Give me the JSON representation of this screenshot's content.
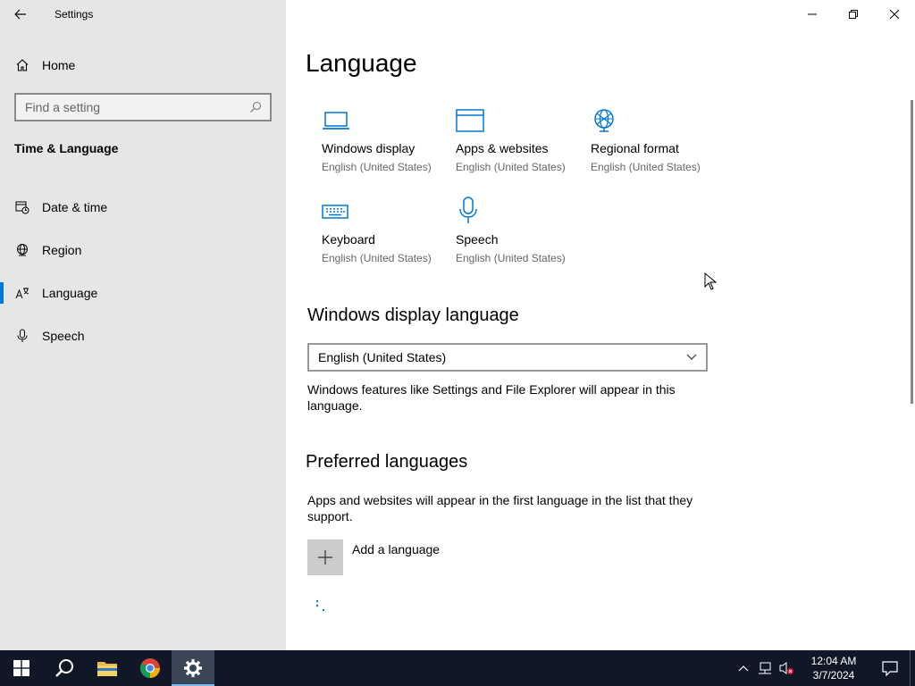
{
  "window": {
    "title": "Settings"
  },
  "sidebar": {
    "home_label": "Home",
    "search_placeholder": "Find a setting",
    "section_title": "Time & Language",
    "items": [
      {
        "label": "Date & time",
        "icon": "clock-calendar-icon",
        "active": false
      },
      {
        "label": "Region",
        "icon": "globe-icon",
        "active": false
      },
      {
        "label": "Language",
        "icon": "language-icon",
        "active": true
      },
      {
        "label": "Speech",
        "icon": "microphone-icon",
        "active": false
      }
    ]
  },
  "main": {
    "page_title": "Language",
    "tiles": [
      {
        "label": "Windows display",
        "sub": "English (United States)",
        "icon": "laptop-icon"
      },
      {
        "label": "Apps & websites",
        "sub": "English (United States)",
        "icon": "browser-window-icon"
      },
      {
        "label": "Regional format",
        "sub": "English (United States)",
        "icon": "regional-globe-icon"
      },
      {
        "label": "Keyboard",
        "sub": "English (United States)",
        "icon": "keyboard-icon"
      },
      {
        "label": "Speech",
        "sub": "English (United States)",
        "icon": "microphone-icon"
      }
    ],
    "display_language": {
      "heading": "Windows display language",
      "selected": "English (United States)",
      "description": "Windows features like Settings and File Explorer will appear in this language."
    },
    "preferred": {
      "heading": "Preferred languages",
      "description": "Apps and websites will appear in the first language in the list that they support.",
      "add_label": "Add a language"
    }
  },
  "taskbar": {
    "time": "12:04 AM",
    "date": "3/7/2024"
  },
  "colors": {
    "accent": "#0078d7",
    "sidebar_bg": "#e6e6e6",
    "taskbar_bg": "#101828"
  }
}
